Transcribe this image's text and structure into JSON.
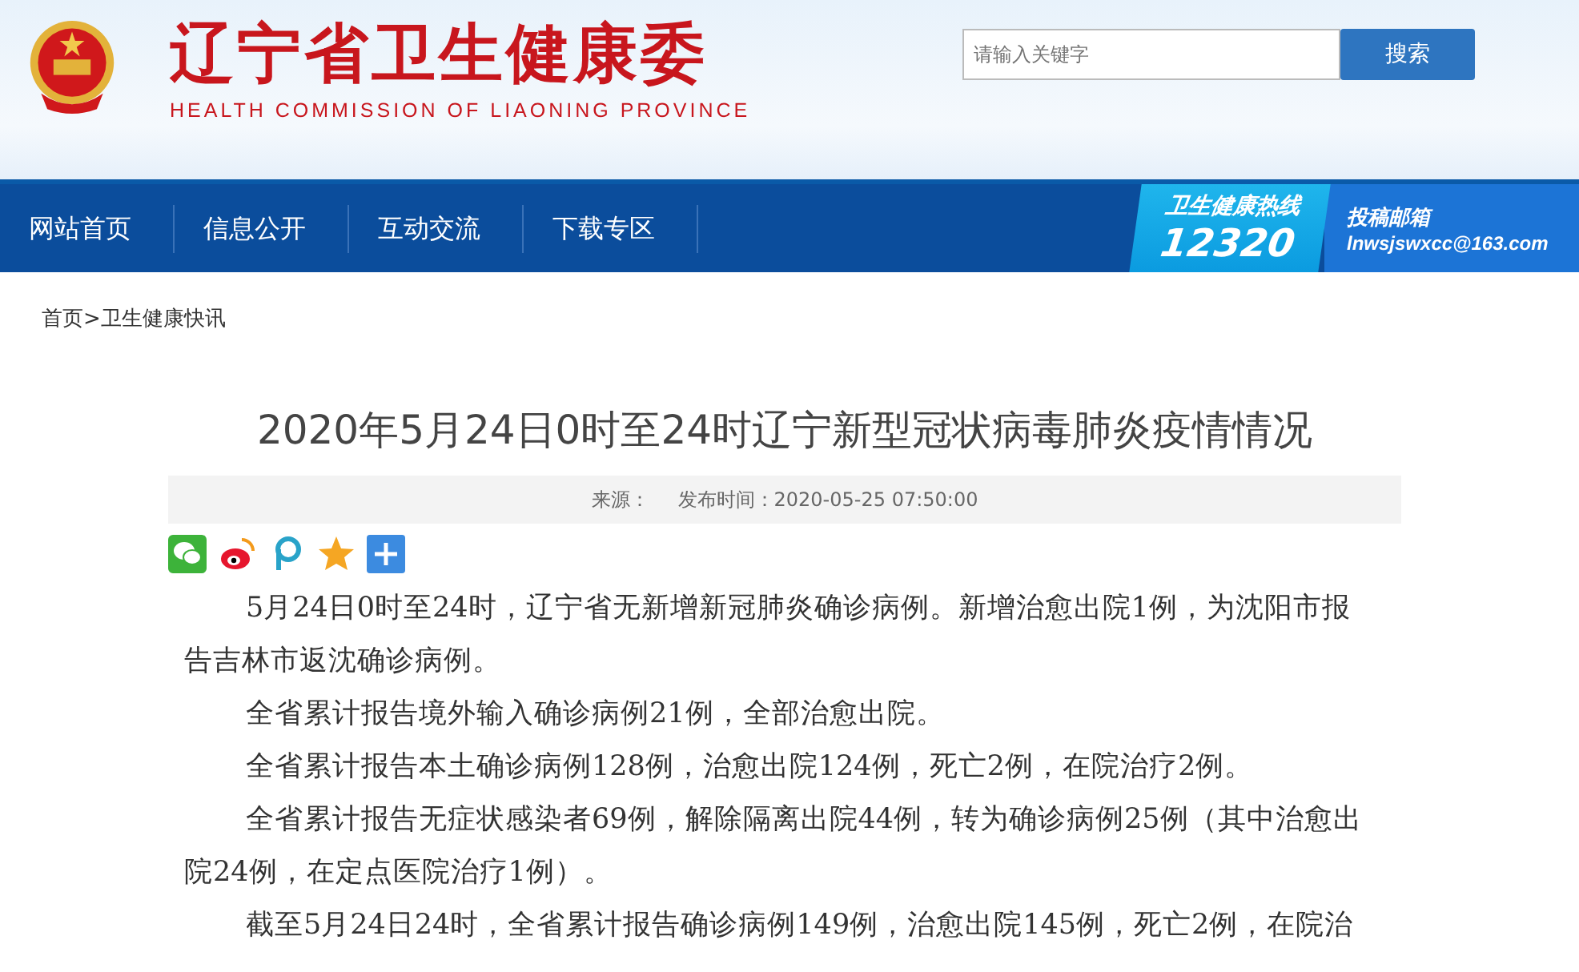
{
  "header": {
    "title": "辽宁省卫生健康委",
    "subtitle": "HEALTH COMMISSION OF LIAONING PROVINCE",
    "search": {
      "placeholder": "请输入关键字",
      "button": "搜索"
    }
  },
  "nav": {
    "items": [
      {
        "label": "网站首页",
        "selected": false
      },
      {
        "label": "信息公开",
        "selected": false
      },
      {
        "label": "互动交流",
        "selected": false
      },
      {
        "label": "下载专区",
        "selected": false
      }
    ],
    "hotline": {
      "label": "卫生健康热线",
      "number": "12320"
    },
    "email": {
      "label": "投稿邮箱",
      "address": "lnwsjswxcc@163.com"
    }
  },
  "breadcrumb": [
    "首页",
    ">",
    "卫生健康快讯"
  ],
  "article": {
    "title": "2020年5月24日0时至24时辽宁新型冠状病毒肺炎疫情情况",
    "source_label": "来源：",
    "published": "发布时间：2020-05-25 07:50:00",
    "share": [
      {
        "kind": "wechat"
      },
      {
        "kind": "weibo"
      },
      {
        "kind": "p"
      },
      {
        "kind": "qzone"
      },
      {
        "kind": "more"
      }
    ],
    "paragraphs": [
      "5月24日0时至24时，辽宁省无新增新冠肺炎确诊病例。新增治愈出院1例，为沈阳市报告吉林市返沈确诊病例。",
      "全省累计报告境外输入确诊病例21例，全部治愈出院。",
      "全省累计报告本土确诊病例128例，治愈出院124例，死亡2例，在院治疗2例。",
      "全省累计报告无症状感染者69例，解除隔离出院44例，转为确诊病例25例（其中治愈出院24例，在定点医院治疗1例）。",
      "截至5月24日24时，全省累计报告确诊病例149例，治愈出院145例，死亡2例，在院治"
    ]
  }
}
